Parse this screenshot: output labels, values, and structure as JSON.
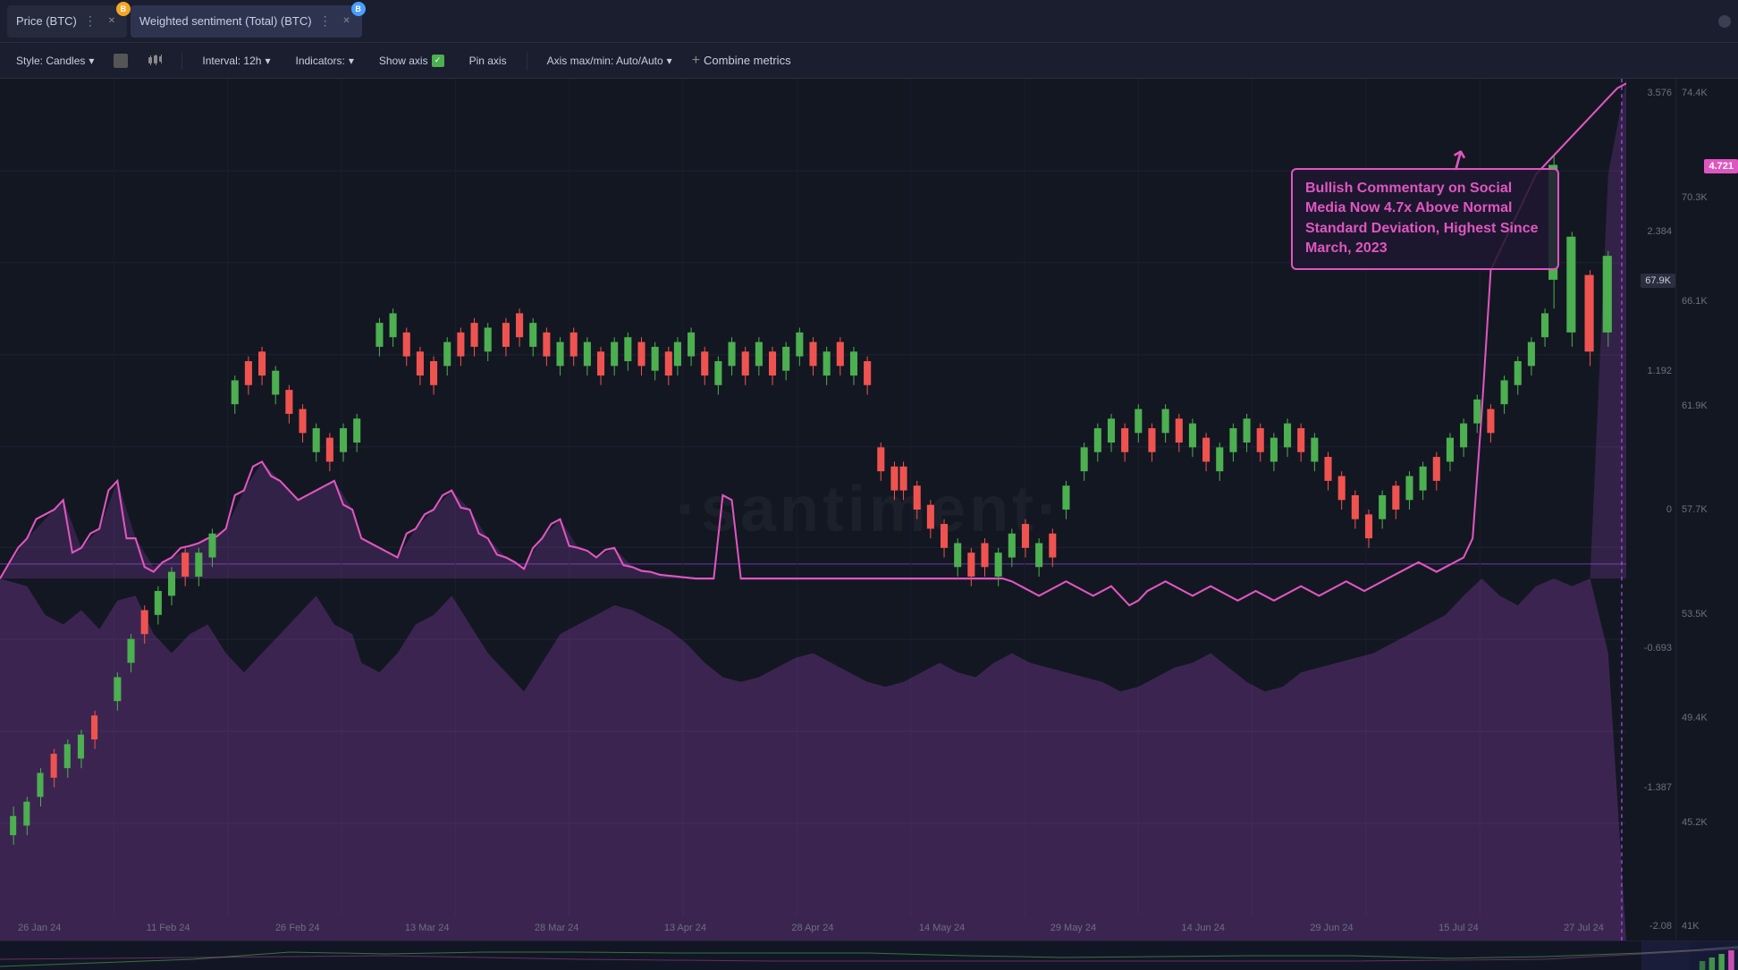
{
  "tabs": [
    {
      "id": "price-btc",
      "label": "Price (BTC)",
      "badge": "B",
      "badge_color": "orange",
      "active": false
    },
    {
      "id": "weighted-sentiment-btc",
      "label": "Weighted sentiment (Total) (BTC)",
      "badge": "B",
      "badge_color": "blue",
      "active": true
    }
  ],
  "toolbar": {
    "style_label": "Style: Candles",
    "interval_label": "Interval: 12h",
    "indicators_label": "Indicators:",
    "show_axis_label": "Show axis",
    "pin_axis_label": "Pin axis",
    "axis_label": "Axis max/min: Auto/Auto",
    "combine_metrics_label": "Combine metrics"
  },
  "chart": {
    "watermark": "·santiment·",
    "annotation": {
      "text": "Bullish Commentary on Social Media Now 4.7x Above Normal Standard Deviation, Highest Since March, 2023",
      "arrow": "↗"
    },
    "price_label": "4.721",
    "price_level": "67.9K",
    "y_axis_price": [
      "74.4K",
      "70.3K",
      "66.1K",
      "61.9K",
      "57.7K",
      "53.5K",
      "49.4K",
      "45.2K",
      "41K"
    ],
    "y_axis_sentiment": [
      "3.576",
      "2.384",
      "1.192",
      "0",
      "-0.693",
      "-1.387",
      "-2.08"
    ],
    "x_axis": [
      "26 Jan 24",
      "11 Feb 24",
      "26 Feb 24",
      "13 Mar 24",
      "28 Mar 24",
      "13 Apr 24",
      "28 Apr 24",
      "14 May 24",
      "29 May 24",
      "14 Jun 24",
      "29 Jun 24",
      "15 Jul 24",
      "27 Jul 24"
    ]
  },
  "minimap": {
    "visible": true
  }
}
